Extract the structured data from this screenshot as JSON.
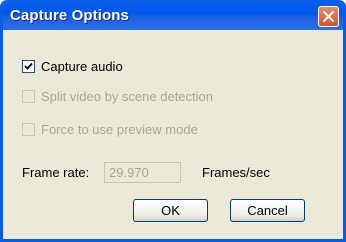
{
  "window": {
    "title": "Capture Options"
  },
  "options": [
    {
      "label": "Capture audio",
      "checked": true,
      "enabled": true
    },
    {
      "label": "Split video by scene detection",
      "checked": false,
      "enabled": false
    },
    {
      "label": "Force to use preview mode",
      "checked": false,
      "enabled": false
    }
  ],
  "frame_rate": {
    "label": "Frame rate:",
    "value": "29.970",
    "unit": "Frames/sec"
  },
  "buttons": {
    "ok": "OK",
    "cancel": "Cancel"
  },
  "colors": {
    "title_bar": "#0a5ee6",
    "close_button": "#d4552b",
    "dialog_bg": "#ece9d8"
  }
}
